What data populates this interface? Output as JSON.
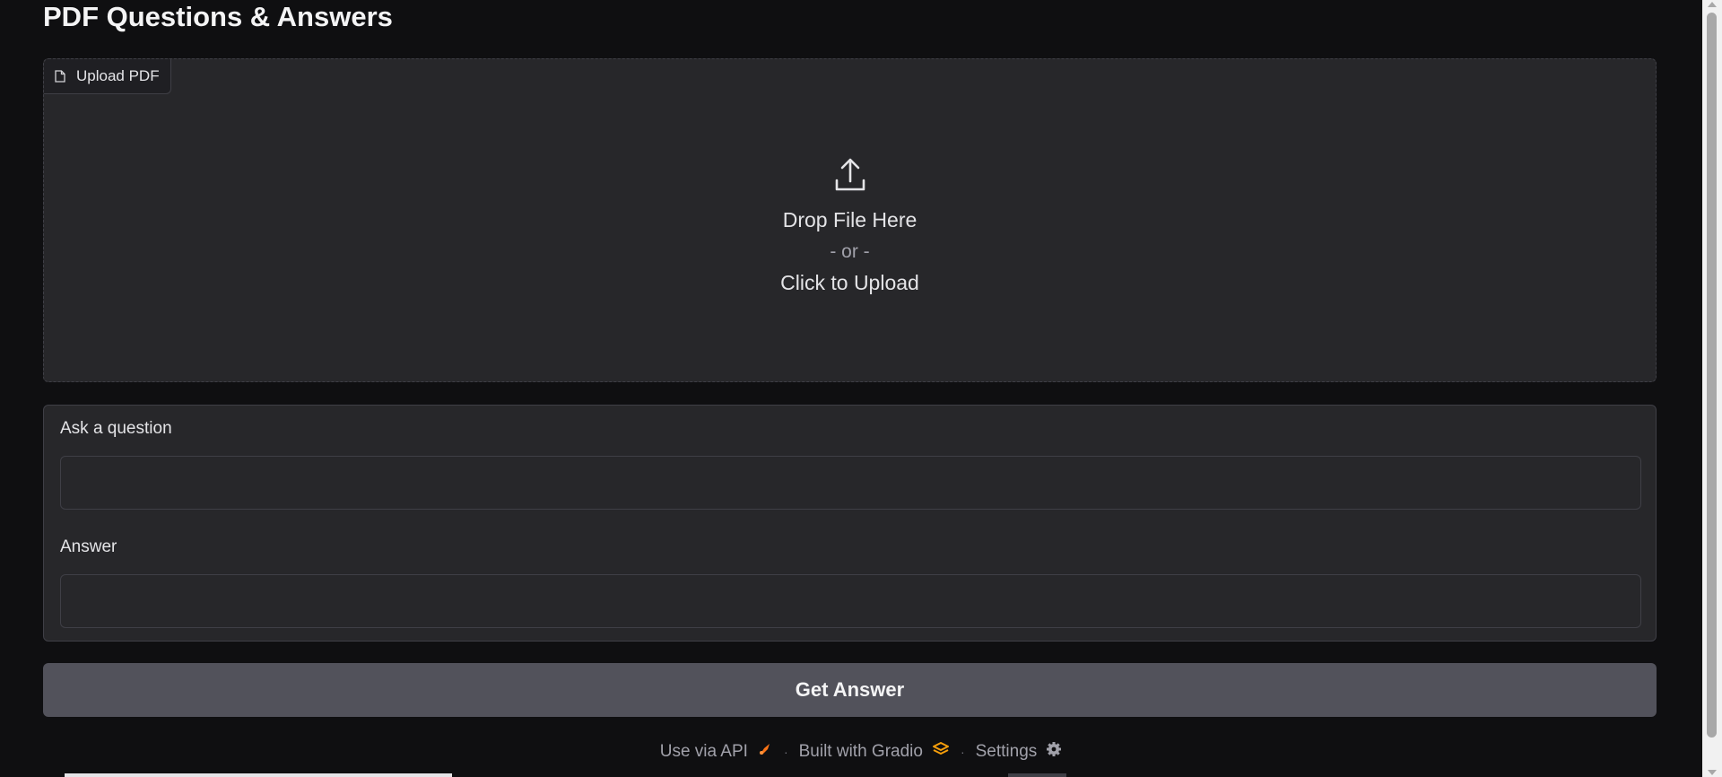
{
  "page": {
    "title": "PDF Questions & Answers"
  },
  "upload": {
    "tag_label": "Upload PDF",
    "drop_text": "Drop File Here",
    "or_text": "- or -",
    "click_text": "Click to Upload"
  },
  "form": {
    "question_label": "Ask a question",
    "question_value": "",
    "answer_label": "Answer",
    "answer_value": ""
  },
  "actions": {
    "submit_label": "Get Answer"
  },
  "footer": {
    "api_label": "Use via API",
    "built_label": "Built with Gradio",
    "settings_label": "Settings",
    "separator": "·"
  },
  "colors": {
    "background": "#0f0f11",
    "panel": "#27272a",
    "border": "#3f3f46",
    "button": "#52525b",
    "text": "#f4f4f5",
    "accent_orange": "#f97316"
  },
  "icons": {
    "tag": "file-icon",
    "upload": "upload-icon",
    "api": "rocket-icon",
    "gradio": "gradio-logo-icon",
    "settings": "gear-icon"
  }
}
